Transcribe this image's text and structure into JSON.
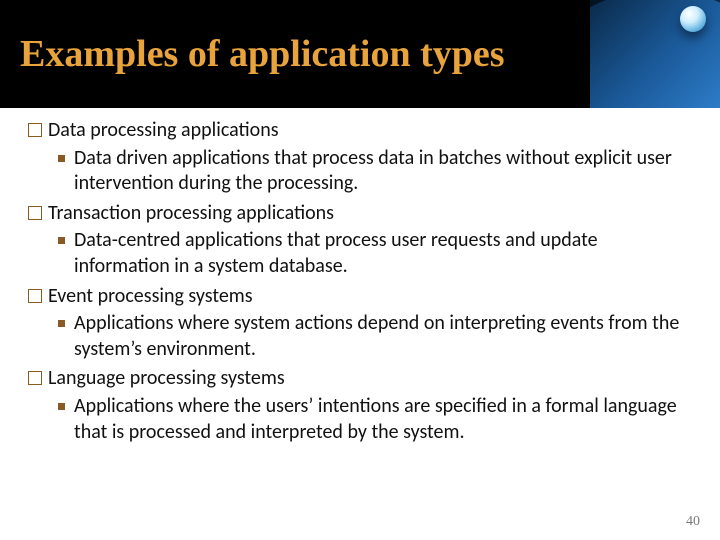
{
  "title": "Examples of application types",
  "bullets": [
    {
      "heading": "Data processing applications",
      "sub": "Data driven applications that process data in batches without explicit user intervention during the processing."
    },
    {
      "heading": "Transaction processing applications",
      "sub": "Data-centred applications that process user requests and update information in a system database."
    },
    {
      "heading": "Event processing systems",
      "sub": "Applications where system actions depend on interpreting events from the system’s environment."
    },
    {
      "heading": "Language processing systems",
      "sub": "Applications where the users’ intentions are specified in a formal language that is processed and interpreted by the system."
    }
  ],
  "page_number": "40"
}
